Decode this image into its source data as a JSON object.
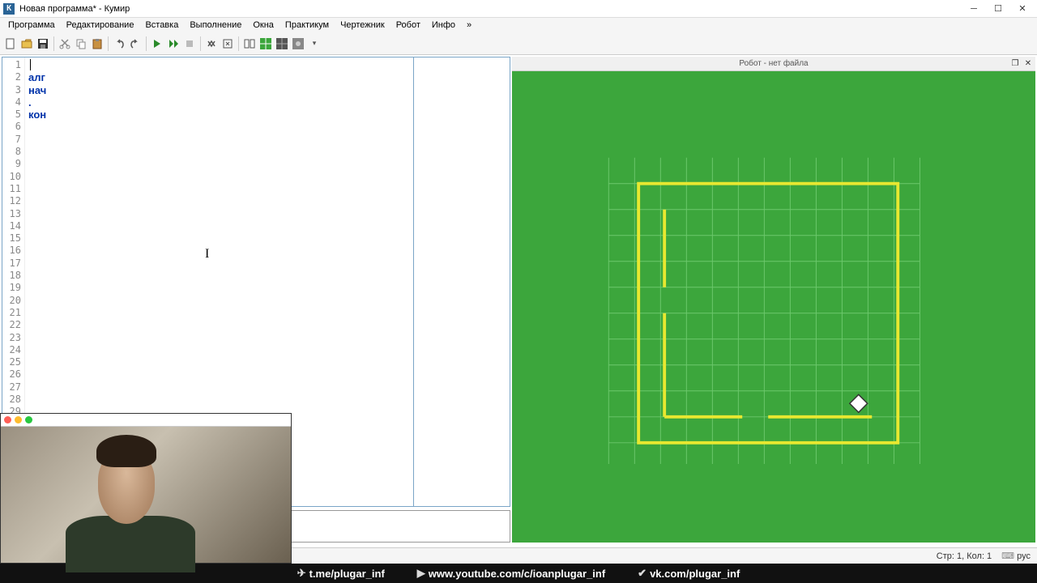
{
  "window": {
    "title": "Новая программа* - Кумир",
    "app_icon_letter": "К"
  },
  "menu": {
    "items": [
      "Программа",
      "Редактирование",
      "Вставка",
      "Выполнение",
      "Окна",
      "Практикум",
      "Чертежник",
      "Робот",
      "Инфо",
      "»"
    ]
  },
  "toolbar": {
    "buttons": [
      "new",
      "open",
      "save",
      "cut",
      "copy",
      "paste",
      "undo",
      "redo",
      "run",
      "step",
      "stop",
      "toggle",
      "compile",
      "split",
      "grid-green",
      "grid-dark",
      "grid-config",
      "dropdown"
    ]
  },
  "editor": {
    "lines": [
      "",
      "алг",
      "нач",
      ".",
      "кон",
      "",
      "",
      "",
      "",
      "",
      "",
      "",
      "",
      "",
      "",
      "",
      "",
      "",
      "",
      "",
      "",
      "",
      "",
      "",
      "",
      "",
      "",
      "",
      "",
      ""
    ],
    "cursor_text_pos": "I"
  },
  "robot_panel": {
    "title": "Робот - нет файла"
  },
  "status": {
    "pos": "Стр: 1, Кол: 1",
    "lang": "рус"
  },
  "bottombar": {
    "links": [
      {
        "icon": "✈",
        "text": "t.me/plugar_inf"
      },
      {
        "icon": "▶",
        "text": "www.youtube.com/c/ioanplugar_inf"
      },
      {
        "icon": "✔",
        "text": "vk.com/plugar_inf"
      }
    ]
  },
  "webcam_dots": [
    "#ff5f57",
    "#febc2e",
    "#28c840"
  ]
}
